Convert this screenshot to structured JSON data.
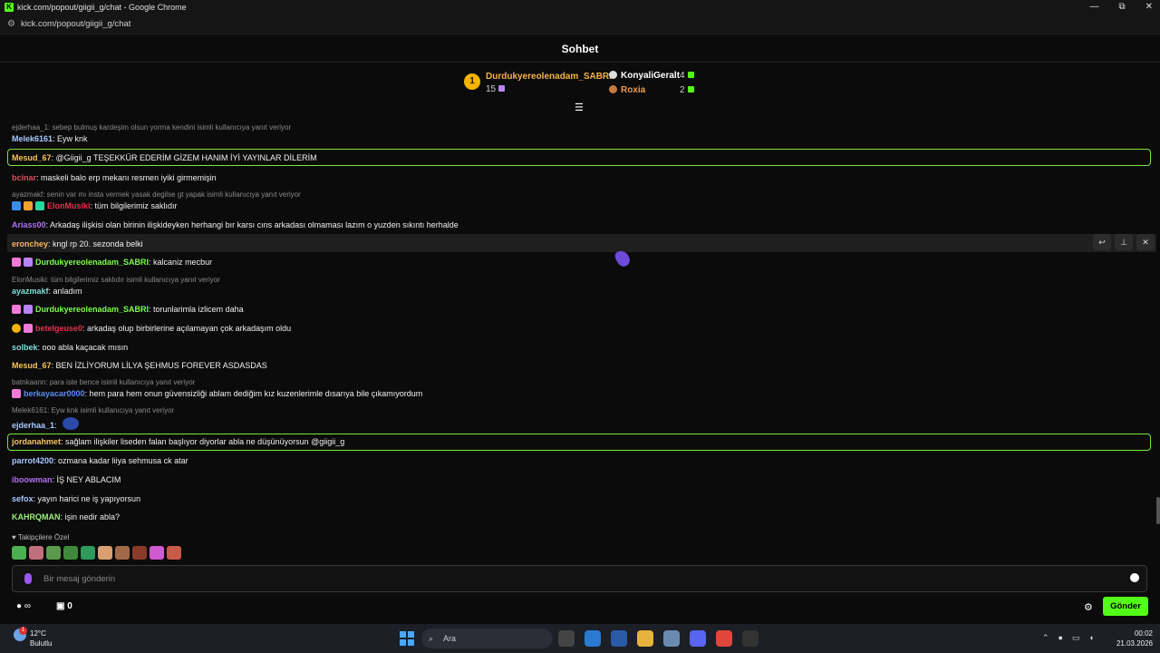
{
  "browser": {
    "title": "kick.com/popout/giigii_g/chat - Google Chrome",
    "url": "kick.com/popout/giigii_g/chat",
    "minimize": "—",
    "restore": "⧉",
    "close": "✕"
  },
  "chat_header": "Sohbet",
  "leaderboard": {
    "first": {
      "rank": "1",
      "name": "Durdukyereolenadam_SABRI",
      "count": "15"
    },
    "second": {
      "name": "KonyaliGeralt",
      "count": "4"
    },
    "third": {
      "name": "Roxia",
      "count": "2"
    }
  },
  "messages": [
    {
      "user": "Melek6161",
      "text": ": Eyw knk",
      "reply": "ejderhaa_1: sebep bulmuş kardeşim olsun yorma kendini isimli kullanıcıya yanıt veriyor"
    },
    {
      "user": "Mesud_67",
      "text": ": @Giigii_g TEŞEKKÜR EDERİM GİZEM HANIM İYİ YAYINLAR DİLERİM"
    },
    {
      "user": "bcinar",
      "text": ": maskeli balo erp mekanı resmen iyiki girmemişin"
    },
    {
      "user": "ElonMusiki",
      "text": ": tüm bilgilerimiz saklıdır",
      "reply": "ayazmakf: senin var mı insta vermek yasak degilse gt yapak isimli kullanıcıya yanıt veriyor"
    },
    {
      "user": "Ariass00",
      "text": ": Arkadaş ilişkisi olan birinin ilişkideyken herhangi bır karsı cıns arkadası olmaması lazım o yuzden sıkıntı herhalde"
    },
    {
      "user": "eronchey",
      "text": ": kngl rp 20. sezonda belki"
    },
    {
      "user": "Durdukyereolenadam_SABRI",
      "text": ": kalcaniz mecbur"
    },
    {
      "user": "ayazmakf",
      "text": ": anladım",
      "reply": "ElonMusiki: tüm bilgilerimiz saklıdır isimli kullanıcıya yanıt veriyor"
    },
    {
      "user": "Durdukyereolenadam_SABRI",
      "text": ": torunlarimla izlicem daha"
    },
    {
      "user": "betelgeuse0",
      "text": ": arkadaş olup birbirlerine açılamayan çok arkadaşım oldu"
    },
    {
      "user": "solbek",
      "text": ": ooo abla kaçacak mısın"
    },
    {
      "user": "Mesud_67",
      "text": ": BEN İZLİYORUM LİLYA ŞEHMUS FOREVER ASDASDAS"
    },
    {
      "user": "berkayacar0000",
      "text": ": hem para hem onun güvensizliği ablam dediğim kız kuzenlerimle dısarıya bile çıkamıyordum",
      "reply": "batnkaann: para iste bence isimli kullanıcıya yanıt veriyor"
    },
    {
      "user": "ejderhaa_1",
      "text": ":",
      "reply": "Melek6161: Eyw knk isimli kullanıcıya yanıt veriyor"
    },
    {
      "user": "jordanahmet",
      "text": ": sağlam ilişkiler liseden falan başlıyor diyorlar abla ne düşünüyorsun @giigii_g"
    },
    {
      "user": "parrot4200",
      "text": ": ozmana kadar liiya sehmusa ck atar"
    },
    {
      "user": "iboowman",
      "text": ": İŞ NEY ABLACIM"
    },
    {
      "user": "sefox",
      "text": ": yayın harici ne iş yapıyorsun"
    },
    {
      "user": "KAHRQMAN",
      "text": ": işin nedir abla?"
    }
  ],
  "colors": {
    "accent": "#53fc18",
    "Melek6161": "#a8c8ff",
    "Mesud_67": "#f5c45a",
    "bcinar": "#e04b5a",
    "ElonMusiki": "#e0334d",
    "Ariass00": "#b070f0",
    "eronchey": "#f5b45a",
    "Durdukyereolenadam_SABRI": "#7dfc4a",
    "ayazmakf": "#7ce0d8",
    "betelgeuse0": "#e0334d",
    "solbek": "#7ce0d8",
    "berkayacar0000": "#5a8cf0",
    "ejderhaa_1": "#a8c8ff",
    "jordanahmet": "#f5c45a",
    "parrot4200": "#a8c8ff",
    "iboowman": "#b070f0",
    "sefox": "#a8c8ff",
    "KAHRQMAN": "#9cf07a"
  },
  "followers_label": "Takipçilere Özel",
  "input_placeholder": "Bir mesaj gönderin",
  "bottom": {
    "infinity": "∞",
    "gift_count": "0",
    "send_label": "Gönder"
  },
  "taskbar": {
    "temp": "12°C",
    "weather": "Bulutlu",
    "weather_badge": "1",
    "search": "Ara",
    "time": "00:02",
    "date": "21.03.2026"
  }
}
